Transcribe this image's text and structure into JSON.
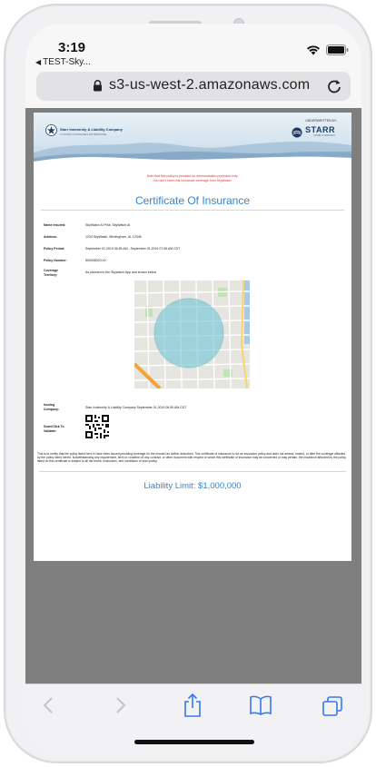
{
  "status_bar": {
    "time": "3:19",
    "back_app": "TEST-Sky..."
  },
  "address_bar": {
    "url": "s3-us-west-2.amazonaws.com"
  },
  "document": {
    "issuer": {
      "name": "Starr Indemnity & Liability Company",
      "tagline": "A STARR COMPANIES ENTERPRISE"
    },
    "underwriter": {
      "label": "UNDERWRITTEN BY:",
      "name": "STARR",
      "sub": "STARR COMPANIES"
    },
    "notice_line1": "Note that this policy is provided for demonstration purposes only.",
    "notice_line2": "You don't have real insurance coverage from SkyWatch.",
    "title": "Certificate Of Insurance",
    "fields": [
      {
        "key": "Name Insured:",
        "value": "SkyWatch AI Pilot, SkyWatch.AI"
      },
      {
        "key": "Address:",
        "value": "1234 SkyWatch, Birmingham, AL 12345"
      },
      {
        "key": "Policy Period:",
        "value": "September 01,2019 06:55 AM - September 01,2019 07:55 AM CDT"
      },
      {
        "key": "Policy Number:",
        "value": "800008320-00"
      },
      {
        "key": "Coverage Territory:",
        "value": "As planned in the Skywatch App and shown below"
      },
      {
        "key": "Issuing Company:",
        "value": "Starr Indemnity & Liability Company     September 01,2019 06:55 AM CDT"
      },
      {
        "key": "Scan/Click To Validate:",
        "value": ""
      }
    ],
    "disclaimer": "This is to certify that the policy listed here in have been issued providing coverage for the Insured as further described. This certificate of insurance is not an insurance policy and does not amend, extend, or alter the coverage afforded by the policy listed herein. Notwithstanding any requirement, term or condition of any contract, or other document with respect to which this certificate of insurance may be concerned or may pertain, the insurance afforded by the policy listed on this certificate is subject to all the terms, exclusions, and conditions of such policy.",
    "liability_limit": "Liability Limit: $1,000,000"
  },
  "colors": {
    "accent_blue": "#2f86d3",
    "notice_red": "#dd3333",
    "safari_blue": "#3478f6",
    "coverage_circle": "#6fc4d6"
  },
  "toolbar": {
    "items": [
      "back-icon",
      "forward-icon",
      "share-icon",
      "bookmarks-icon",
      "tabs-icon"
    ]
  }
}
